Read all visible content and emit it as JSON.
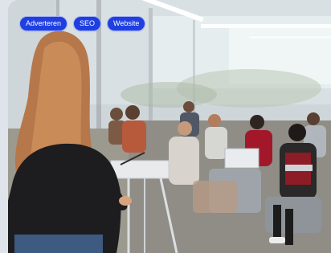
{
  "tags": [
    "Adverteren",
    "SEO",
    "Website"
  ],
  "colors": {
    "tag_background": "#1f3fe0",
    "tag_text": "#ffffff",
    "page_background": "#dfe3ea"
  }
}
